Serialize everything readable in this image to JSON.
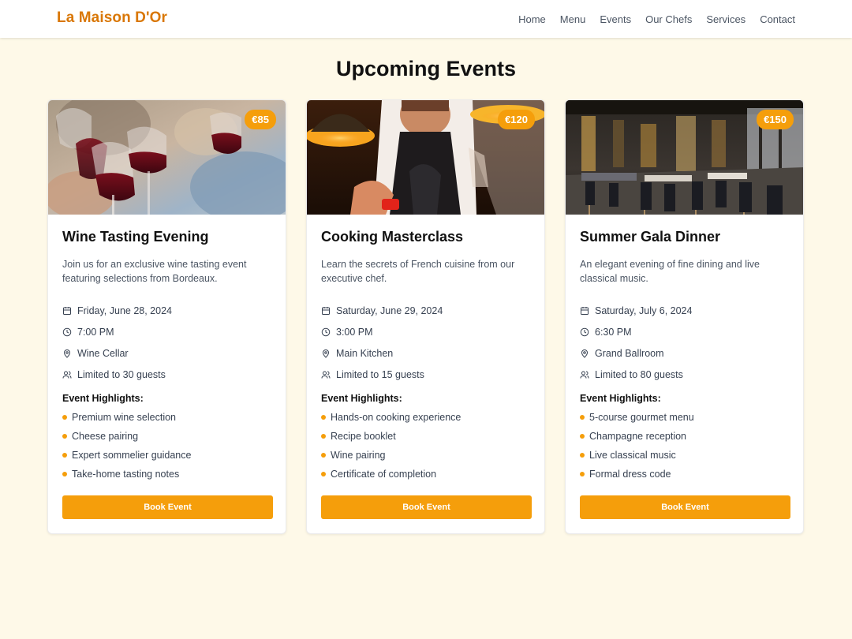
{
  "brand": "La Maison D'Or",
  "nav": [
    "Home",
    "Menu",
    "Events",
    "Our Chefs",
    "Services",
    "Contact"
  ],
  "page_title": "Upcoming Events",
  "highlights_heading": "Event Highlights:",
  "book_label": "Book Event",
  "colors": {
    "accent": "#f59e0b",
    "brand": "#d97706",
    "background": "#fef9e8"
  },
  "events": [
    {
      "price": "€85",
      "title": "Wine Tasting Evening",
      "description": "Join us for an exclusive wine tasting event featuring selections from Bordeaux.",
      "date": "Friday, June 28, 2024",
      "time": "7:00 PM",
      "location": "Wine Cellar",
      "capacity": "Limited to 30 guests",
      "highlights": [
        "Premium wine selection",
        "Cheese pairing",
        "Expert sommelier guidance",
        "Take-home tasting notes"
      ]
    },
    {
      "price": "€120",
      "title": "Cooking Masterclass",
      "description": "Learn the secrets of French cuisine from our executive chef.",
      "date": "Saturday, June 29, 2024",
      "time": "3:00 PM",
      "location": "Main Kitchen",
      "capacity": "Limited to 15 guests",
      "highlights": [
        "Hands-on cooking experience",
        "Recipe booklet",
        "Wine pairing",
        "Certificate of completion"
      ]
    },
    {
      "price": "€150",
      "title": "Summer Gala Dinner",
      "description": "An elegant evening of fine dining and live classical music.",
      "date": "Saturday, July 6, 2024",
      "time": "6:30 PM",
      "location": "Grand Ballroom",
      "capacity": "Limited to 80 guests",
      "highlights": [
        "5-course gourmet menu",
        "Champagne reception",
        "Live classical music",
        "Formal dress code"
      ]
    }
  ]
}
